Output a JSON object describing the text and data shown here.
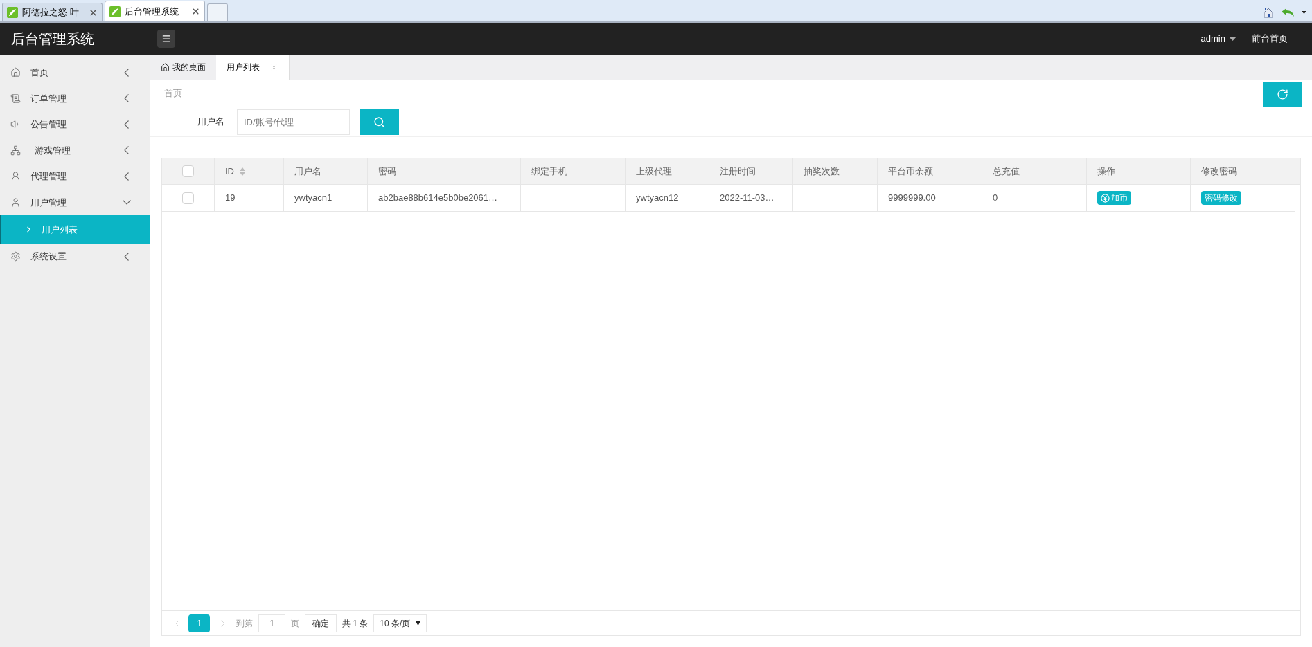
{
  "browser_tabs": [
    {
      "title": "阿德拉之怒 叶",
      "selected": false
    },
    {
      "title": "后台管理系统",
      "selected": true
    }
  ],
  "header": {
    "title": "后台管理系统",
    "user": "admin",
    "front_link": "前台首页"
  },
  "sidebar": {
    "items": [
      {
        "label": "首页",
        "kind": "home",
        "expanded": false
      },
      {
        "label": "订单管理",
        "kind": "order",
        "expanded": false
      },
      {
        "label": "公告管理",
        "kind": "speaker",
        "expanded": false
      },
      {
        "label": "游戏管理",
        "kind": "network",
        "expanded": false
      },
      {
        "label": "代理管理",
        "kind": "agent",
        "expanded": false
      },
      {
        "label": "用户管理",
        "kind": "user",
        "expanded": true,
        "children": [
          {
            "label": "用户列表",
            "selected": true
          }
        ]
      },
      {
        "label": "系统设置",
        "kind": "settings",
        "expanded": false
      }
    ]
  },
  "page_tabs": [
    {
      "label": "我的桌面",
      "kind": "home",
      "selected": false
    },
    {
      "label": "用户列表",
      "kind": "closable",
      "selected": true
    }
  ],
  "breadcrumb": "首页",
  "search": {
    "label": "用户名",
    "placeholder": "ID/账号/代理"
  },
  "table": {
    "columns": [
      {
        "label": "ID",
        "sortable": true
      },
      {
        "label": "用户名",
        "sortable": false
      },
      {
        "label": "密码",
        "sortable": false
      },
      {
        "label": "绑定手机",
        "sortable": false
      },
      {
        "label": "上级代理",
        "sortable": false
      },
      {
        "label": "注册时间",
        "sortable": false
      },
      {
        "label": "抽奖次数",
        "sortable": false
      },
      {
        "label": "平台币余额",
        "sortable": false
      },
      {
        "label": "总充值",
        "sortable": false
      },
      {
        "label": "操作",
        "sortable": false
      },
      {
        "label": "修改密码",
        "sortable": false
      }
    ],
    "header_checked": false,
    "rows": [
      {
        "checked": false,
        "cells": [
          "19",
          "ywtyacn1",
          "ab2bae88b614e5b0be2061…",
          "",
          "ywtyacn12",
          "2022-11-03…",
          "",
          "9999999.00",
          "0"
        ],
        "actions": [
          {
            "label": "加币",
            "kind": "coin"
          },
          {
            "label": "密码修改",
            "kind": "plain"
          }
        ]
      }
    ]
  },
  "pagination": {
    "pages": [
      {
        "label": "1",
        "selected": true
      }
    ],
    "goto_label": "到第",
    "goto_value": "1",
    "page_unit": "页",
    "confirm": "确定",
    "total": "共 1 条",
    "page_size": "10 条/页"
  }
}
